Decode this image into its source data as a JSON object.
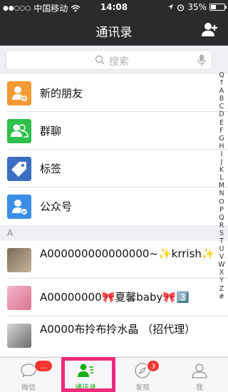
{
  "status_bar": {
    "carrier": "中国移动",
    "time": "14:08",
    "battery": "35%",
    "battery_level": 0.35
  },
  "nav": {
    "title": "通讯录",
    "add_icon": "add-contact-icon"
  },
  "search": {
    "placeholder": "搜索"
  },
  "functions": [
    {
      "label": "新的朋友",
      "icon": "new-friend-icon",
      "color": "#f39a36"
    },
    {
      "label": "群聊",
      "icon": "group-chat-icon",
      "color": "#2ec04a"
    },
    {
      "label": "标签",
      "icon": "tag-icon",
      "color": "#3b6ec2"
    },
    {
      "label": "公众号",
      "icon": "official-account-icon",
      "color": "#3a8ee6"
    }
  ],
  "section_a": "A",
  "contacts": [
    {
      "name": "A000000000000000~✨krrish✨"
    },
    {
      "name": "A00000000🎀夏馨baby🎀3️⃣"
    },
    {
      "name": "A0000布拎布拎水晶 （招代理）"
    }
  ],
  "index_letters": [
    "Q",
    "↑",
    "A",
    "B",
    "C",
    "D",
    "E",
    "F",
    "G",
    "H",
    "I",
    "J",
    "K",
    "L",
    "M",
    "N",
    "O",
    "P",
    "Q",
    "R",
    "S",
    "T",
    "U",
    "V",
    "W",
    "X",
    "Y",
    "Z",
    "#"
  ],
  "tabs": [
    {
      "label": "微信",
      "badge": "..."
    },
    {
      "label": "通讯录",
      "badge": ""
    },
    {
      "label": "发现",
      "badge": "3"
    },
    {
      "label": "我",
      "badge": ""
    }
  ],
  "colors": {
    "dark_bar": "#2b2b2e",
    "accent_green": "#1aad19",
    "badge_red": "#f43530",
    "highlight_pink": "#ee2a7b"
  }
}
